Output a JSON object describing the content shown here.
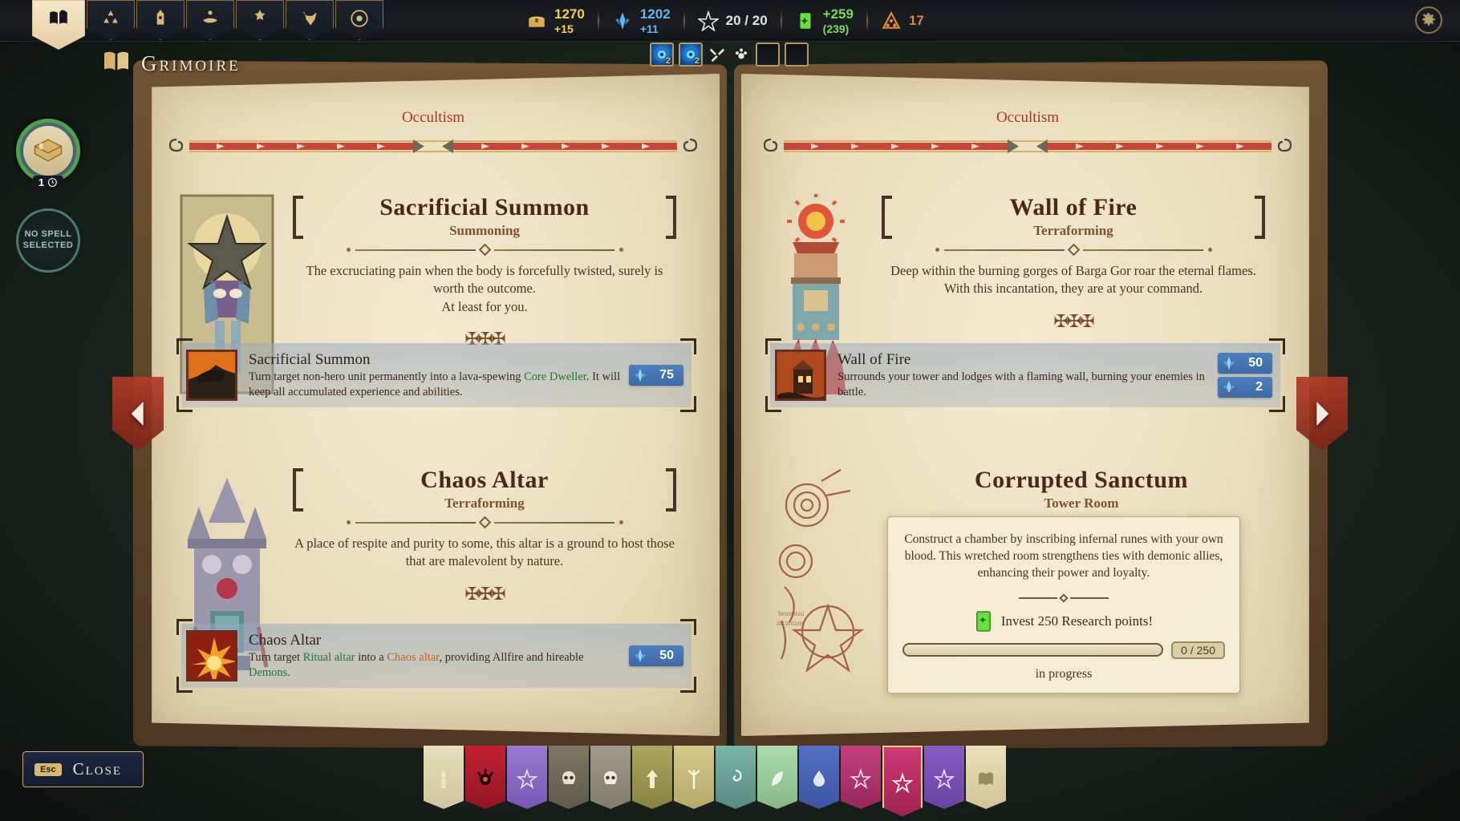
{
  "window": {
    "screen_title": "Grimoire"
  },
  "tabs": [
    {
      "name": "grimoire",
      "icon": "open-book-icon",
      "active": true
    },
    {
      "name": "factions",
      "icon": "triangle-runes-icon",
      "active": false
    },
    {
      "name": "tower",
      "icon": "tower-icon",
      "active": false
    },
    {
      "name": "offerings",
      "icon": "hand-offering-icon",
      "active": false
    },
    {
      "name": "artifacts",
      "icon": "artifact-icon",
      "active": false
    },
    {
      "name": "units",
      "icon": "beast-skull-icon",
      "active": false
    },
    {
      "name": "astrology",
      "icon": "orbit-icon",
      "active": false
    }
  ],
  "resources": [
    {
      "key": "gold",
      "icon": "treasure-chest-icon",
      "value": "1270",
      "delta": "+15",
      "color": "#f3d24a"
    },
    {
      "key": "mana",
      "icon": "mana-crystal-icon",
      "value": "1202",
      "delta": "+11",
      "color": "#63b7f0"
    },
    {
      "key": "spell_slots",
      "icon": "pentagram-icon",
      "value": "20 / 20",
      "delta": "",
      "color": "#dfe6ea"
    },
    {
      "key": "research",
      "icon": "research-book-icon",
      "value": "+259",
      "delta": "(239)",
      "color": "#7ddc55"
    },
    {
      "key": "unrest",
      "icon": "warning-triangle-icon",
      "value": "17",
      "delta": "",
      "color": "#e08a2e"
    }
  ],
  "minibar": {
    "slots": [
      {
        "type": "portal",
        "badge": "2",
        "filled": true
      },
      {
        "type": "portal",
        "badge": "2",
        "filled": true
      },
      {
        "type": "empty",
        "badge": "",
        "filled": false
      },
      {
        "type": "empty",
        "badge": "",
        "filled": false
      }
    ],
    "tools": [
      "hammer-pick-icon",
      "paw-icon"
    ]
  },
  "settings_button": {
    "icon": "gear-icon"
  },
  "left_rail": {
    "room_chip": {
      "icon": "room-icon",
      "badge_count": "1",
      "badge_icon": "clock-icon",
      "ring_color": "#4fa24b"
    },
    "no_spell": {
      "line1": "NO SPELL",
      "line2": "SELECTED"
    }
  },
  "pages": {
    "left": {
      "header": "Occultism",
      "entries": [
        {
          "title": "Sacrificial Summon",
          "school": "Summoning",
          "flavor": "The excruciating pain when the body is forcefully twisted, surely is worth the outcome.\nAt least for you.",
          "art": "tarot-occultist-art",
          "card": {
            "name": "Sacrificial Summon",
            "icon": "lava-beast-icon",
            "desc_parts": [
              {
                "text": "Turn target non-hero unit permanently into a lava-spewing ",
                "style": "normal"
              },
              {
                "text": "Core Dweller",
                "style": "green"
              },
              {
                "text": ". It will keep all accumulated experience and abilities.",
                "style": "normal"
              }
            ],
            "costs": [
              {
                "icon": "mana-crystal-icon",
                "value": "75",
                "type": "mana"
              }
            ]
          }
        },
        {
          "title": "Chaos Altar",
          "school": "Terraforming",
          "flavor": "A place of respite and purity to some, this altar is a ground to host those that are malevolent by nature.",
          "art": "gothic-altar-art",
          "card": {
            "name": "Chaos Altar",
            "icon": "flaming-altar-icon",
            "desc_parts": [
              {
                "text": "Turn target ",
                "style": "normal"
              },
              {
                "text": "Ritual altar",
                "style": "green"
              },
              {
                "text": " into a ",
                "style": "normal"
              },
              {
                "text": "Chaos altar",
                "style": "orange"
              },
              {
                "text": ", providing Allfire and hireable ",
                "style": "normal"
              },
              {
                "text": "Demons",
                "style": "green"
              },
              {
                "text": ".",
                "style": "normal"
              }
            ],
            "costs": [
              {
                "icon": "mana-crystal-icon",
                "value": "50",
                "type": "mana"
              }
            ]
          }
        }
      ]
    },
    "right": {
      "header": "Occultism",
      "entries": [
        {
          "title": "Wall of Fire",
          "school": "Terraforming",
          "flavor": "Deep within the burning gorges of Barga Gor roar the eternal flames.\nWith this incantation, they are at your command.",
          "art": "burning-tower-art",
          "card": {
            "name": "Wall of Fire",
            "icon": "burning-tower-icon",
            "desc_parts": [
              {
                "text": "Surrounds your tower and lodges with a flaming wall, burning your enemies in battle.",
                "style": "normal"
              }
            ],
            "costs": [
              {
                "icon": "mana-crystal-icon",
                "value": "50",
                "type": "mana"
              },
              {
                "icon": "mana-upkeep-icon",
                "value": "2",
                "type": "upkeep"
              }
            ]
          }
        }
      ],
      "research_entry": {
        "title": "Corrupted Sanctum",
        "subtitle": "Tower Room",
        "body": "Construct a chamber by inscribing infernal runes with your own blood. This wretched room strengthens ties with demonic allies, enhancing their power and loyalty.",
        "invest_label": "Invest 250 Research points!",
        "invest_icon": "research-book-icon",
        "progress_value": "0 / 250",
        "progress_percent": 0,
        "status": "in progress"
      }
    }
  },
  "navigation": {
    "prev": {
      "icon": "chevron-left-icon"
    },
    "next": {
      "icon": "chevron-right-icon"
    }
  },
  "bookmarks": [
    {
      "name": "bookmark-parchment",
      "color": "#ddd7b4",
      "icon": "candle-icon",
      "selected": false
    },
    {
      "name": "bookmark-blood",
      "color": "#b01f2e",
      "icon": "blood-eye-icon",
      "selected": false
    },
    {
      "name": "bookmark-arcane",
      "color": "#8a6fc4",
      "icon": "star-icon",
      "selected": false
    },
    {
      "name": "bookmark-bone",
      "color": "#6f6a55",
      "icon": "skull-icon",
      "selected": false
    },
    {
      "name": "bookmark-gray",
      "color": "#918d7c",
      "icon": "skull-icon",
      "selected": false
    },
    {
      "name": "bookmark-olive",
      "color": "#9a9457",
      "icon": "arrow-up-icon",
      "selected": false
    },
    {
      "name": "bookmark-sand",
      "color": "#c9bb7e",
      "icon": "rune-icon",
      "selected": false
    },
    {
      "name": "bookmark-teal",
      "color": "#6ba69a",
      "icon": "swirl-icon",
      "selected": false
    },
    {
      "name": "bookmark-mint",
      "color": "#9dc6a0",
      "icon": "leaf-icon",
      "selected": false
    },
    {
      "name": "bookmark-blue",
      "color": "#4a63b0",
      "icon": "drop-icon",
      "selected": false
    },
    {
      "name": "bookmark-magenta",
      "color": "#b5356e",
      "icon": "pentagram-icon",
      "selected": false
    },
    {
      "name": "bookmark-occultism",
      "color": "#c0306a",
      "icon": "pentagram-icon",
      "selected": true
    },
    {
      "name": "bookmark-violet",
      "color": "#7a4fb5",
      "icon": "pentagram-icon",
      "selected": false
    },
    {
      "name": "bookmark-cream",
      "color": "#e2d9b3",
      "icon": "book-icon",
      "selected": false
    }
  ],
  "close_button": {
    "key": "Esc",
    "label": "Close"
  }
}
